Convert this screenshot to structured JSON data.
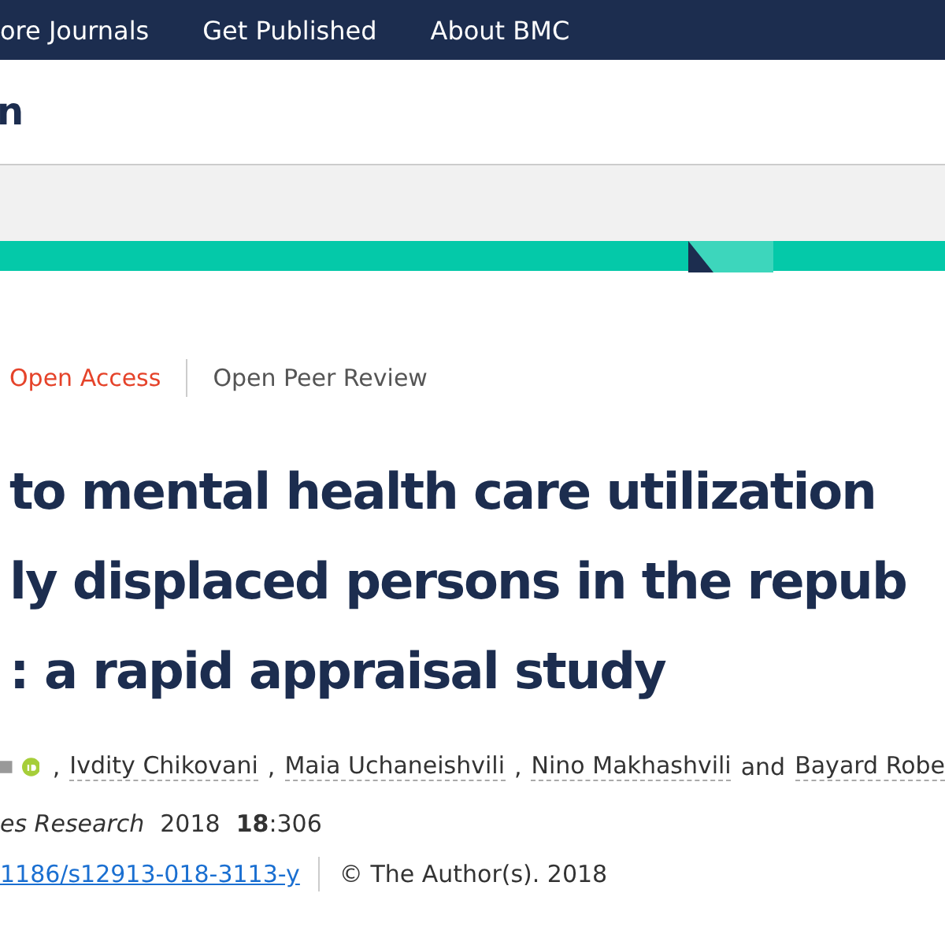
{
  "top_nav": {
    "items": [
      "ore Journals",
      "Get Published",
      "About BMC"
    ]
  },
  "header": {
    "logo_fragment": "n"
  },
  "article": {
    "badges": [
      {
        "label": "Open Access",
        "kind": "access"
      },
      {
        "label": "Open Peer Review",
        "kind": "review"
      }
    ],
    "title_lines": [
      "to mental health care utilization",
      "ly displaced persons in the repub",
      ": a rapid appraisal study"
    ],
    "authors": [
      {
        "name": "Ivdity Chikovani",
        "prefix": ","
      },
      {
        "name": "Maia Uchaneishvili",
        "prefix": ","
      },
      {
        "name": "Nino Makhashvili",
        "prefix": ","
      },
      {
        "name": "Bayard Robe",
        "prefix": "and"
      }
    ],
    "journal": {
      "name": "es Research",
      "year": "2018",
      "citation": "**18**:306"
    },
    "doi": "1186/s12913-018-3113-y",
    "copyright": "©  The Author(s). 2018"
  }
}
